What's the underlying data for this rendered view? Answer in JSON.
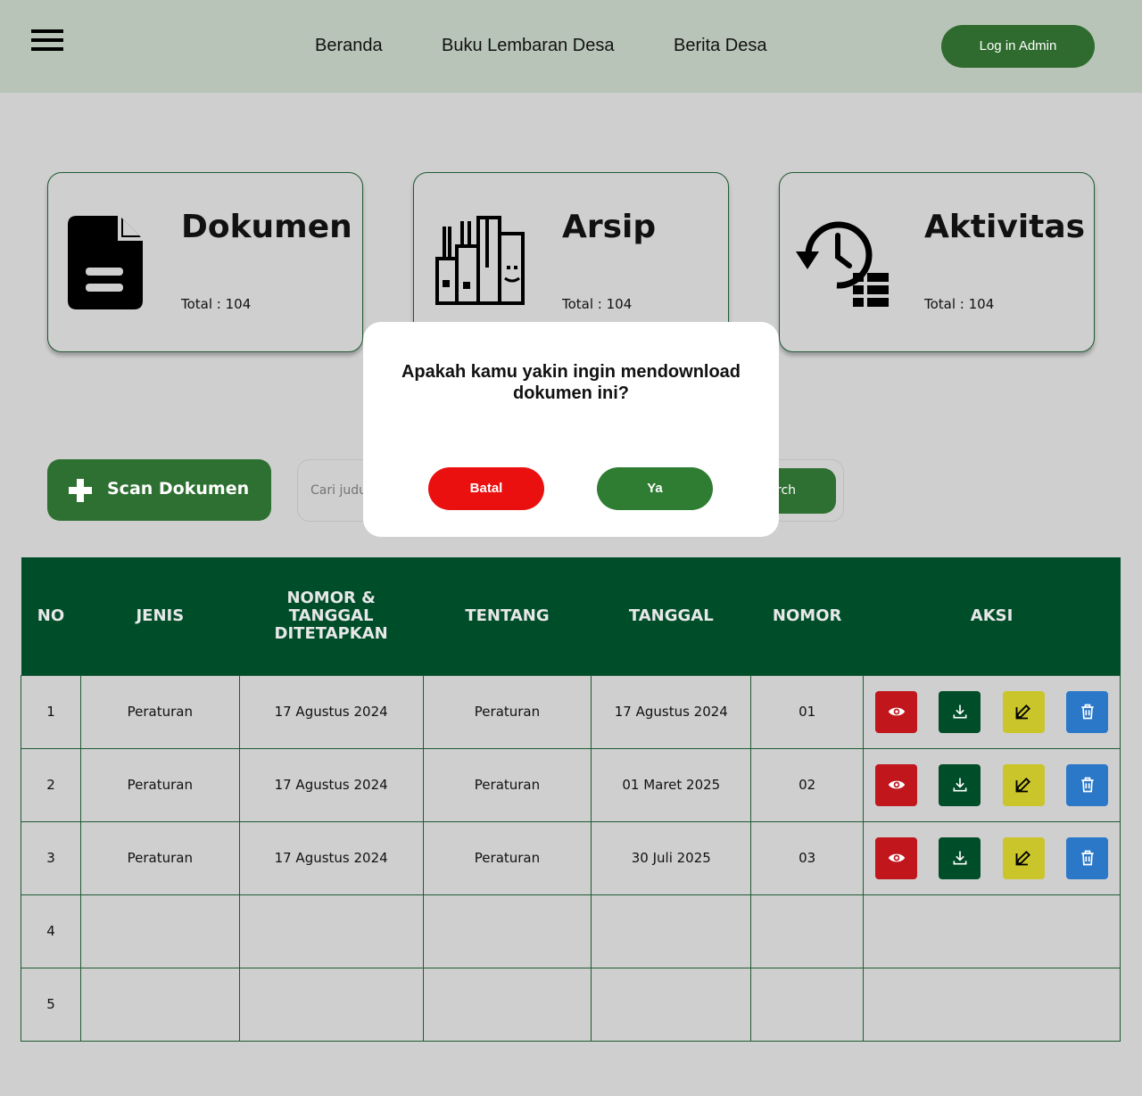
{
  "header": {
    "nav": [
      "Beranda",
      "Buku Lembaran Desa",
      "Berita Desa"
    ],
    "login_label": "Log in Admin"
  },
  "cards": [
    {
      "title": "Dokumen",
      "total": "Total : 104",
      "icon": "document-icon"
    },
    {
      "title": "Arsip",
      "total": "Total : 104",
      "icon": "archive-icon"
    },
    {
      "title": "Aktivitas",
      "total": "Total : 104",
      "icon": "activity-history-icon"
    }
  ],
  "toolbar": {
    "scan_label": "Scan Dokumen",
    "search_placeholder": "Cari judul",
    "search_button": "Search"
  },
  "table": {
    "headers": [
      "NO",
      "JENIS",
      "NOMOR & TANGGAL DITETAPKAN",
      "TENTANG",
      "TANGGAL",
      "NOMOR",
      "AKSI"
    ],
    "rows": [
      [
        "1",
        "Peraturan",
        "17 Agustus 2024",
        "Peraturan",
        "17 Agustus 2024",
        "01"
      ],
      [
        "2",
        "Peraturan",
        "17 Agustus 2024",
        "Peraturan",
        "01 Maret 2025",
        "02"
      ],
      [
        "3",
        "Peraturan",
        "17 Agustus 2024",
        "Peraturan",
        "30 Juli 2025",
        "03"
      ],
      [
        "4",
        "",
        "",
        "",
        "",
        ""
      ],
      [
        "5",
        "",
        "",
        "",
        "",
        ""
      ]
    ],
    "action_icons": [
      "eye-icon",
      "download-icon",
      "edit-icon",
      "trash-icon"
    ]
  },
  "modal": {
    "question": "Apakah kamu yakin ingin mendownload dokumen ini?",
    "cancel_label": "Batal",
    "confirm_label": "Ya"
  },
  "colors": {
    "header_bg": "#b8c4b8",
    "primary_green": "#2f6b2f",
    "table_header": "#004d2a",
    "danger": "#ea1010",
    "edit_yellow": "#c9c52a",
    "delete_blue": "#2b78c9"
  }
}
